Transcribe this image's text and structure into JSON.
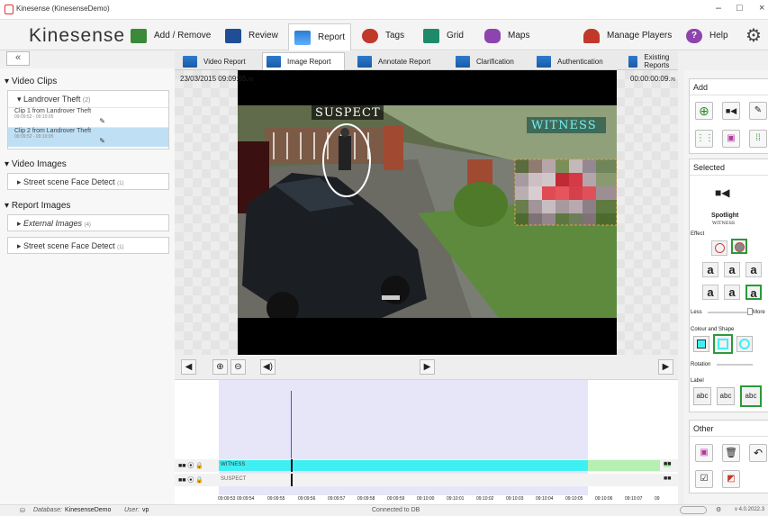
{
  "window": {
    "title": "Kinesense (KinesenseDemo)",
    "controls": [
      "–",
      "□",
      "×"
    ]
  },
  "brand": "Kinesense",
  "menu": [
    {
      "label": "Add / Remove",
      "icon": "add-remove-icon",
      "color": "#3a8a3a"
    },
    {
      "label": "Review",
      "icon": "review-icon",
      "color": "#1f4e96"
    },
    {
      "label": "Report",
      "icon": "report-icon",
      "color": "#2a7cd0"
    },
    {
      "label": "Tags",
      "icon": "tags-icon",
      "color": "#c0392b"
    },
    {
      "label": "Grid",
      "icon": "grid-icon",
      "color": "#1f8a6a"
    },
    {
      "label": "Maps",
      "icon": "maps-icon",
      "color": "#8e44ad"
    },
    {
      "label": "Manage Players",
      "icon": "manage-players-icon",
      "color": "#c0392b"
    },
    {
      "label": "Help",
      "icon": "help-icon",
      "color": "#8e44ad"
    }
  ],
  "tabs": [
    "Video Report",
    "Image Report",
    "Annotate Report",
    "Clarification",
    "Authentication",
    "Existing Reports"
  ],
  "left": {
    "collapse": "«",
    "video_clips": "Video Clips",
    "group": "Landrover Theft",
    "group_count": "(2)",
    "clips": [
      {
        "title": "Clip 1 from Landrover Theft",
        "time": "09:09:52 - 09:10:05"
      },
      {
        "title": "Clip 2 from Landrover Theft",
        "time": "09:09:52 - 09:10:05"
      }
    ],
    "video_images": "Video Images",
    "vi_item": "Street scene Face Detect",
    "vi_count": "(1)",
    "report_images": "Report Images",
    "ri_items": [
      {
        "label": "External Images",
        "count": "(4)"
      },
      {
        "label": "Street scene Face Detect",
        "count": "(1)"
      }
    ]
  },
  "stage": {
    "ts_left": "23/03/2015 09:09:55.",
    "ts_left_ms": "70",
    "ts_right": "00:00:00:09.",
    "ts_right_ms": "76",
    "suspect": "SUSPECT",
    "witness": "WITNESS"
  },
  "timeline": {
    "tracks": [
      {
        "name": "WITNESS",
        "color": "#3ff0f3"
      },
      {
        "name": "SUSPECT",
        "color": "#e8e8e8"
      }
    ],
    "ticks": [
      "09:09:53",
      "09:09:54",
      "09:09:55",
      "09:09:56",
      "09:09:57",
      "09:09:58",
      "09:09:59",
      "09:10:00",
      "09:10:01",
      "09:10:02",
      "09:10:03",
      "09:10:04",
      "09:10:05",
      "09:10:06",
      "09:10:07",
      "09"
    ]
  },
  "right": {
    "add": "Add",
    "selected": "Selected",
    "spotlight": "Spotlight",
    "spotlight_sub": "WITNESS",
    "effect": "Effect",
    "less": "Less",
    "more": "More",
    "colour_shape": "Colour and Shape",
    "rotation": "Rotation",
    "label": "Label",
    "label_btns": [
      "abc",
      "abc",
      "abc"
    ],
    "fx_letters": [
      "a",
      "a",
      "a",
      "a",
      "a",
      "a"
    ],
    "other": "Other"
  },
  "status": {
    "db_label": "Database:",
    "db": "KinesenseDemo",
    "user_label": "User:",
    "user": "vp",
    "center": "Connected to DB",
    "version": "v 4.0.2022.3"
  }
}
